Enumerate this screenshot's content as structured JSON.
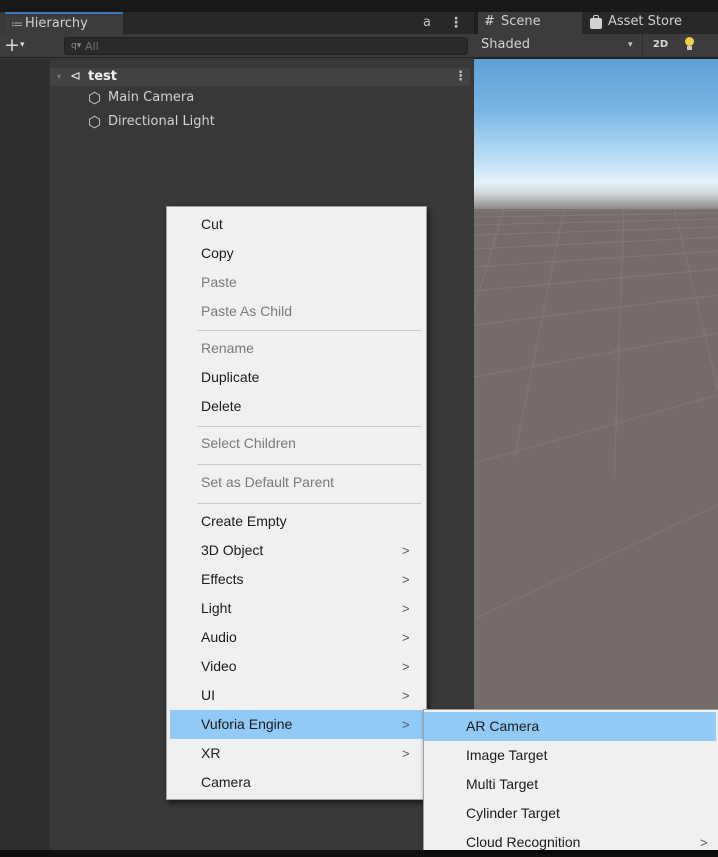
{
  "hierarchy": {
    "tab_label": "Hierarchy",
    "tab_icon": "≔",
    "lock_icon": "a",
    "menu_icon": "⋮",
    "add_label": "+",
    "add_arrow": "▾",
    "search_icon": "q▾",
    "search_placeholder": "All",
    "scene": {
      "name": "test",
      "fold": "▾",
      "icon": "⊲",
      "menu_icon": "⋮"
    },
    "objects": [
      {
        "label": "Main Camera",
        "icon": "⬡"
      },
      {
        "label": "Directional Light",
        "icon": "⬡"
      }
    ]
  },
  "scene_view": {
    "tab_label": "Scene",
    "tab_icon": "#",
    "asset_store_label": "Asset Store",
    "shading_mode": "Shaded",
    "shading_arrow": "▾",
    "toggle_2d": "2D"
  },
  "context_menu": {
    "items": [
      {
        "label": "Cut",
        "disabled": false
      },
      {
        "label": "Copy",
        "disabled": false
      },
      {
        "label": "Paste",
        "disabled": true
      },
      {
        "label": "Paste As Child",
        "disabled": true
      },
      {
        "label": "Rename",
        "disabled": true
      },
      {
        "label": "Duplicate",
        "disabled": false
      },
      {
        "label": "Delete",
        "disabled": false
      },
      {
        "label": "Select Children",
        "disabled": true
      },
      {
        "label": "Set as Default Parent",
        "disabled": true
      },
      {
        "label": "Create Empty",
        "disabled": false
      },
      {
        "label": "3D Object",
        "disabled": false,
        "submenu_arrow": ">"
      },
      {
        "label": "Effects",
        "disabled": false,
        "submenu_arrow": ">"
      },
      {
        "label": "Light",
        "disabled": false,
        "submenu_arrow": ">"
      },
      {
        "label": "Audio",
        "disabled": false,
        "submenu_arrow": ">"
      },
      {
        "label": "Video",
        "disabled": false,
        "submenu_arrow": ">"
      },
      {
        "label": "UI",
        "disabled": false,
        "submenu_arrow": ">"
      },
      {
        "label": "Vuforia Engine",
        "disabled": false,
        "submenu_arrow": ">",
        "selected": true
      },
      {
        "label": "XR",
        "disabled": false,
        "submenu_arrow": ">"
      },
      {
        "label": "Camera",
        "disabled": false
      }
    ]
  },
  "vuforia_submenu": {
    "items": [
      {
        "label": "AR Camera",
        "selected": true
      },
      {
        "label": "Image Target"
      },
      {
        "label": "Multi Target"
      },
      {
        "label": "Cylinder Target"
      },
      {
        "label": "Cloud Recognition",
        "submenu_arrow": ">"
      }
    ]
  },
  "colors": {
    "panel_bg": "#383838",
    "tab_accent": "#3a79bb",
    "menu_bg": "#f0f0f0",
    "menu_highlight": "#91c9f7",
    "disabled_text": "#7a7a7a",
    "scene_ground": "#756d6a"
  }
}
